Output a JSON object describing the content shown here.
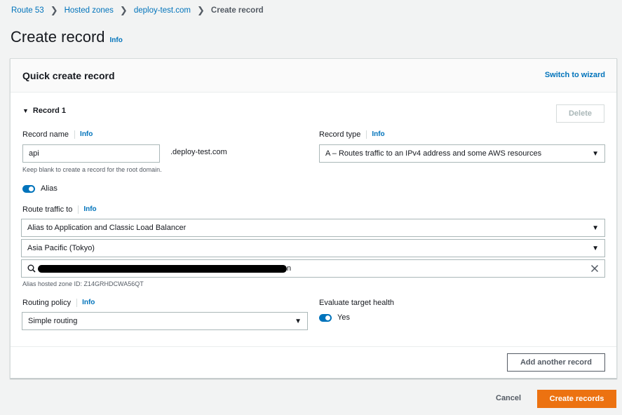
{
  "breadcrumb": {
    "items": [
      "Route 53",
      "Hosted zones",
      "deploy-test.com"
    ],
    "current": "Create record"
  },
  "page": {
    "title": "Create record",
    "info": "Info"
  },
  "panel": {
    "title": "Quick create record",
    "switch_wizard": "Switch to wizard"
  },
  "record": {
    "header": "Record 1",
    "delete_label": "Delete",
    "name_label": "Record name",
    "name_info": "Info",
    "name_value": "api",
    "domain_suffix": ".deploy-test.com",
    "name_hint": "Keep blank to create a record for the root domain.",
    "type_label": "Record type",
    "type_info": "Info",
    "type_value": "A – Routes traffic to an IPv4 address and some AWS resources",
    "alias_label": "Alias",
    "route_label": "Route traffic to",
    "route_info": "Info",
    "endpoint_type": "Alias to Application and Classic Load Balancer",
    "region": "Asia Pacific (Tokyo)",
    "lb_suffix": "n",
    "zone_id_text": "Alias hosted zone ID: Z14GRHDCWA56QT",
    "routing_label": "Routing policy",
    "routing_info": "Info",
    "routing_value": "Simple routing",
    "health_label": "Evaluate target health",
    "health_value": "Yes"
  },
  "actions": {
    "add_another": "Add another record",
    "cancel": "Cancel",
    "create": "Create records"
  },
  "colors": {
    "accent": "#0073bb",
    "primary": "#ec7211"
  }
}
